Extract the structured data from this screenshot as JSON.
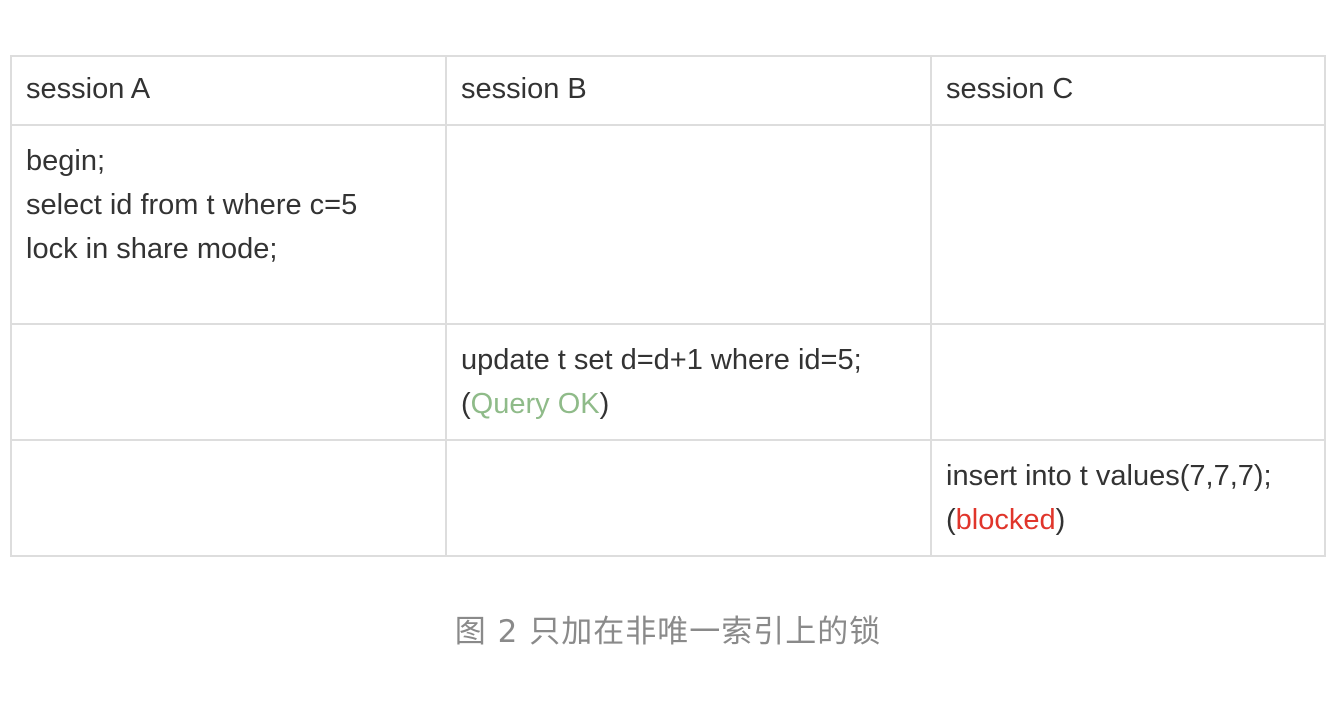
{
  "table": {
    "headers": [
      "session A",
      "session B",
      "session C"
    ],
    "rows": [
      {
        "a": [
          "begin;",
          "select id from t where c=5",
          "lock in share mode;"
        ],
        "b": [],
        "c": []
      },
      {
        "a": [],
        "b": {
          "line1": "update t set d=d+1 where id=5;",
          "open": "(",
          "status": "Query OK",
          "close": ")"
        },
        "c": []
      },
      {
        "a": [],
        "b": [],
        "c": {
          "line1": "insert into t values(7,7,7);",
          "open": "(",
          "status": "blocked",
          "close": ")"
        }
      }
    ]
  },
  "caption": "图 2 只加在非唯一索引上的锁",
  "colors": {
    "text": "#333333",
    "ok": "#8fbb89",
    "blocked": "#e0352b",
    "caption": "#8a8a8a",
    "border": "#dddddd"
  }
}
